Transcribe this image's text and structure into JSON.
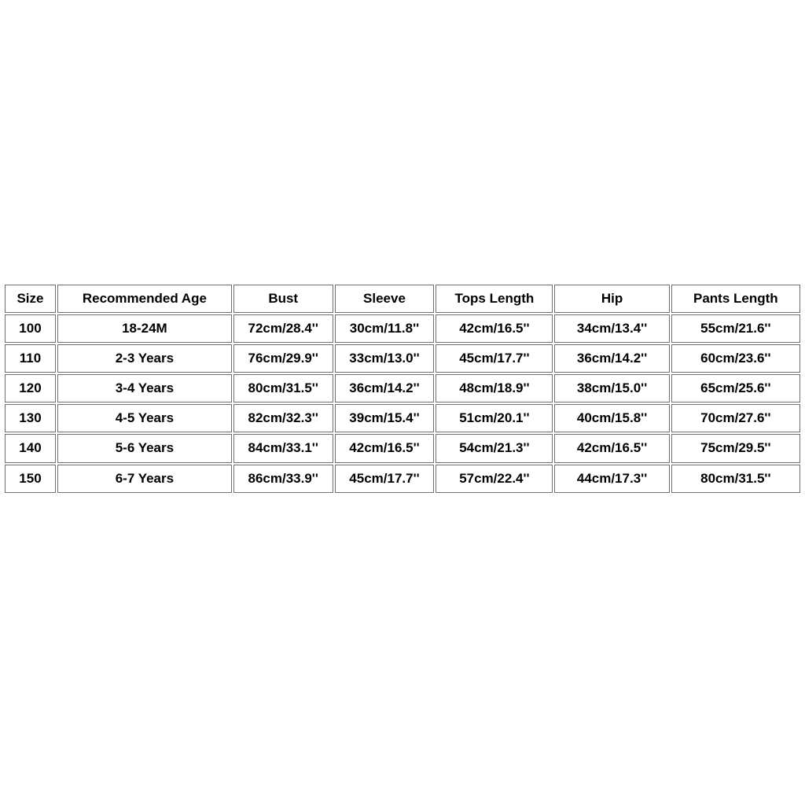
{
  "table": {
    "headers": [
      "Size",
      "Recommended Age",
      "Bust",
      "Sleeve",
      "Tops Length",
      "Hip",
      "Pants Length"
    ],
    "rows": [
      {
        "size": "100",
        "age": "18-24M",
        "bust": "72cm/28.4''",
        "sleeve": "30cm/11.8''",
        "tops": "42cm/16.5''",
        "hip": "34cm/13.4''",
        "pants": "55cm/21.6''"
      },
      {
        "size": "110",
        "age": "2-3 Years",
        "bust": "76cm/29.9''",
        "sleeve": "33cm/13.0''",
        "tops": "45cm/17.7''",
        "hip": "36cm/14.2''",
        "pants": "60cm/23.6''"
      },
      {
        "size": "120",
        "age": "3-4 Years",
        "bust": "80cm/31.5''",
        "sleeve": "36cm/14.2''",
        "tops": "48cm/18.9''",
        "hip": "38cm/15.0''",
        "pants": "65cm/25.6''"
      },
      {
        "size": "130",
        "age": "4-5 Years",
        "bust": "82cm/32.3''",
        "sleeve": "39cm/15.4''",
        "tops": "51cm/20.1''",
        "hip": "40cm/15.8''",
        "pants": "70cm/27.6''"
      },
      {
        "size": "140",
        "age": "5-6 Years",
        "bust": "84cm/33.1''",
        "sleeve": "42cm/16.5''",
        "tops": "54cm/21.3''",
        "hip": "42cm/16.5''",
        "pants": "75cm/29.5''"
      },
      {
        "size": "150",
        "age": "6-7 Years",
        "bust": "86cm/33.9''",
        "sleeve": "45cm/17.7''",
        "tops": "57cm/22.4''",
        "hip": "44cm/17.3''",
        "pants": "80cm/31.5''"
      }
    ]
  }
}
